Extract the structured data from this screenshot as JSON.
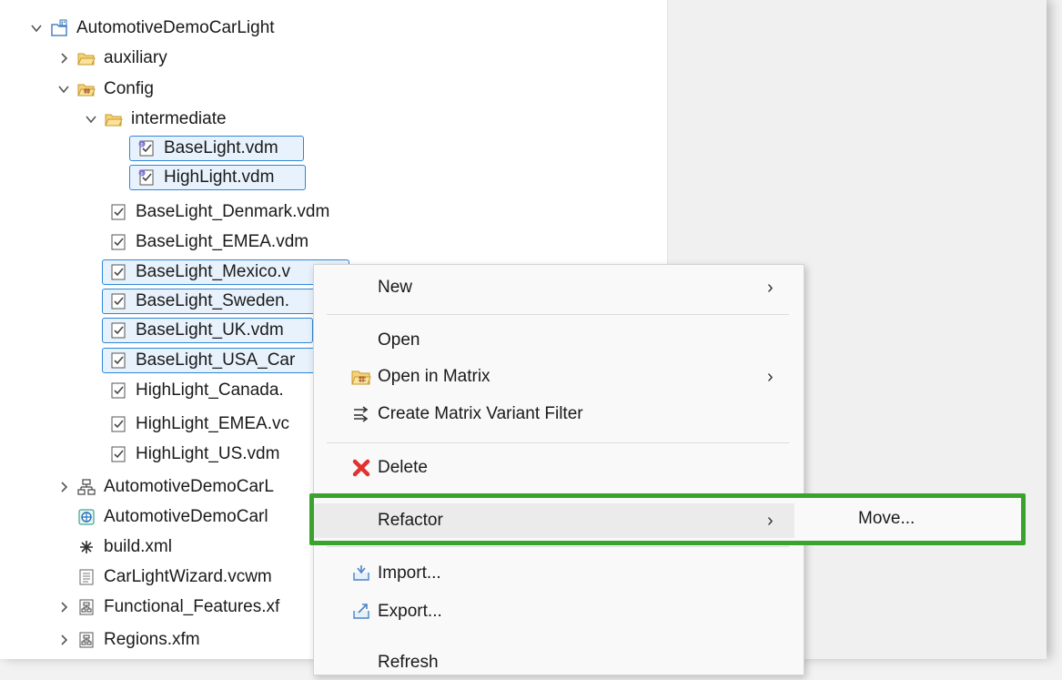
{
  "tree": {
    "root": "AutomotiveDemoCarLight",
    "items": [
      {
        "label": "auxiliary"
      },
      {
        "label": "Config"
      },
      {
        "label": "intermediate"
      },
      {
        "label": "BaseLight.vdm"
      },
      {
        "label": "HighLight.vdm"
      },
      {
        "label": "BaseLight_Denmark.vdm"
      },
      {
        "label": "BaseLight_EMEA.vdm"
      },
      {
        "label": "BaseLight_Mexico.v"
      },
      {
        "label": "BaseLight_Sweden."
      },
      {
        "label": "BaseLight_UK.vdm"
      },
      {
        "label": "BaseLight_USA_Car"
      },
      {
        "label": "HighLight_Canada."
      },
      {
        "label": "HighLight_EMEA.vc"
      },
      {
        "label": "HighLight_US.vdm"
      },
      {
        "label": "AutomotiveDemoCarL"
      },
      {
        "label": "AutomotiveDemoCarl"
      },
      {
        "label": "build.xml"
      },
      {
        "label": "CarLightWizard.vcwm"
      },
      {
        "label": "Functional_Features.xf"
      },
      {
        "label": "Regions.xfm"
      }
    ]
  },
  "context_menu": {
    "items": [
      {
        "label": "New",
        "has_submenu": true
      },
      {
        "label": "Open"
      },
      {
        "label": "Open in Matrix",
        "has_submenu": true
      },
      {
        "label": "Create Matrix Variant Filter"
      },
      {
        "label": "Delete"
      },
      {
        "label": "Refactor",
        "has_submenu": true
      },
      {
        "label": "Import..."
      },
      {
        "label": "Export..."
      },
      {
        "label": "Refresh"
      }
    ],
    "submenu_arrow": "›"
  },
  "refactor_submenu": {
    "items": [
      {
        "label": "Move..."
      }
    ]
  },
  "colors": {
    "highlight_border": "#3aa32d",
    "selection_border": "#2f86d6",
    "delete_icon": "#e0322f"
  }
}
